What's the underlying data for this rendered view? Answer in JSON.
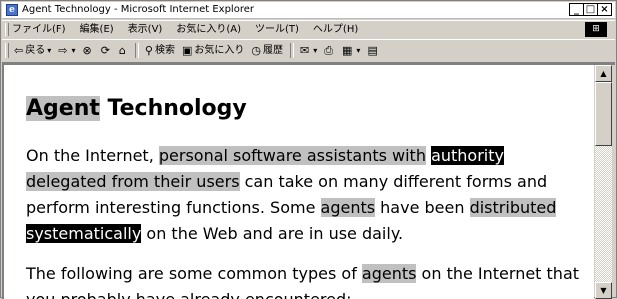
{
  "window": {
    "title": "Agent Technology - Microsoft Internet Explorer",
    "controls": {
      "minimize": "_",
      "maximize": "□",
      "close": "×"
    }
  },
  "menubar": {
    "items": [
      "ファイル(F)",
      "編集(E)",
      "表示(V)",
      "お気に入り(A)",
      "ツール(T)",
      "ヘルプ(H)"
    ]
  },
  "toolbar": {
    "back_label": "戻る",
    "search_label": "検索",
    "favorites_label": "お気に入り",
    "history_label": "履歴"
  },
  "document": {
    "heading_word1": "Agent",
    "heading_word2": " Technology",
    "p1": {
      "s1": "On the Internet, ",
      "s2": "personal software assistants with",
      "s3": " ",
      "s4": "authority",
      "s5": "delegated from their users",
      "s6": " can take on many different forms and perform interesting functions. Some ",
      "s7": "agents",
      "s8": " have been ",
      "s9": "distributed",
      "s10": " ",
      "s11": "systematically",
      "s12": " on the Web and are in use daily."
    },
    "p2": {
      "s1": "The following are some common types of ",
      "s2": "agents",
      "s3": " on the Internet that you probably have already encountered:"
    }
  }
}
